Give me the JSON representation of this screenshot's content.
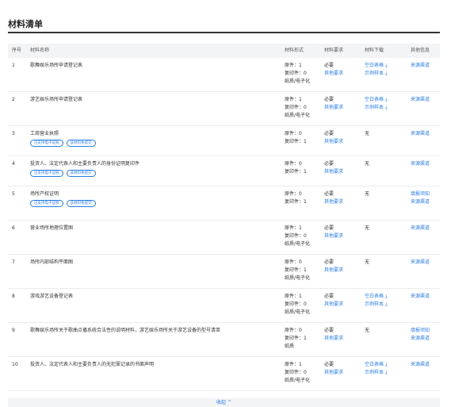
{
  "page_title": "材料清单",
  "headers": {
    "idx": "序号",
    "name": "材料名称",
    "form": "材料形式",
    "req": "材料要求",
    "dl": "材料下载",
    "info": "其他信息"
  },
  "rows": [
    {
      "idx": "1",
      "name": "歌舞娱乐场所申请登记表",
      "tags": [],
      "form": [
        "原件：1",
        "复印件：0",
        "纸质/电子化"
      ],
      "req": [
        "必要",
        "其他要求"
      ],
      "dl": [
        "空白表格",
        "示例样本"
      ],
      "info": [
        "来源渠道"
      ]
    },
    {
      "idx": "2",
      "name": "游艺娱乐场所申请登记表",
      "tags": [],
      "form": [
        "原件：1",
        "复印件：0",
        "纸质/电子化"
      ],
      "req": [
        "必要",
        "其他要求"
      ],
      "dl": [
        "空白表格",
        "示例样本"
      ],
      "info": [
        "来源渠道"
      ]
    },
    {
      "idx": "3",
      "name": "工商营业执照",
      "tags": [
        "已支持电子证照",
        "该材料免提交"
      ],
      "form": [
        "原件：0",
        "复印件：1"
      ],
      "req": [
        "必要",
        "其他要求"
      ],
      "dl": [
        "无"
      ],
      "info": [
        "来源渠道"
      ]
    },
    {
      "idx": "4",
      "name": "投资人、法定代表人和主要负责人的身份证明复印件",
      "tags": [
        "已支持电子证照",
        "该材料免提交"
      ],
      "form": [
        "原件：0",
        "复印件：1"
      ],
      "req": [
        "必要",
        "其他要求"
      ],
      "dl": [
        "无"
      ],
      "info": [
        "来源渠道"
      ]
    },
    {
      "idx": "5",
      "name": "场所产权证明",
      "tags": [
        "已支持电子证照",
        "该材料免提交"
      ],
      "form": [
        "原件：0",
        "复印件：1"
      ],
      "req": [
        "必要",
        "其他要求"
      ],
      "dl": [
        "无"
      ],
      "info": [
        "填报须知",
        "来源渠道"
      ]
    },
    {
      "idx": "6",
      "name": "营业场所地理位置图",
      "tags": [],
      "form": [
        "原件：1",
        "复印件：0",
        "纸质/电子化"
      ],
      "req": [
        "必要",
        "其他要求"
      ],
      "dl": [
        "无"
      ],
      "info": [
        "来源渠道"
      ]
    },
    {
      "idx": "7",
      "name": "场所内部结构平面图",
      "tags": [],
      "form": [
        "原件：0",
        "复印件：1",
        "纸质/电子化"
      ],
      "req": [
        "必要",
        "其他要求"
      ],
      "dl": [
        "无"
      ],
      "info": [
        "来源渠道"
      ]
    },
    {
      "idx": "8",
      "name": "游戏游艺设备登记表",
      "tags": [],
      "form": [
        "原件：1",
        "复印件：0",
        "纸质/电子化"
      ],
      "req": [
        "必要",
        "其他要求"
      ],
      "dl": [
        "空白表格",
        "示例样本"
      ],
      "info": [
        "来源渠道"
      ]
    },
    {
      "idx": "9",
      "name": "歌舞娱乐场所关于歌曲点播系统合法性的说明材料，游艺娱乐场所关于游艺设备的型号清单",
      "tags": [],
      "form": [
        "原件：0",
        "复印件：1",
        "纸质"
      ],
      "req": [
        "必要",
        "其他要求"
      ],
      "dl": [
        "无"
      ],
      "info": [
        "填报须知",
        "来源渠道"
      ]
    },
    {
      "idx": "10",
      "name": "投资人、法定代表人和主要负责人的无犯罪记录的书面声明",
      "tags": [],
      "form": [
        "原件：1",
        "复印件：0",
        "纸质/电子化"
      ],
      "req": [
        "必要",
        "其他要求"
      ],
      "dl": [
        "空白表格",
        "示例样本"
      ],
      "info": [
        "来源渠道"
      ]
    }
  ],
  "collapse_label": "收起 ^",
  "colors": {
    "link": "#2a7de1",
    "header_bg": "#f3f4f6",
    "divider": "#ebebeb"
  }
}
